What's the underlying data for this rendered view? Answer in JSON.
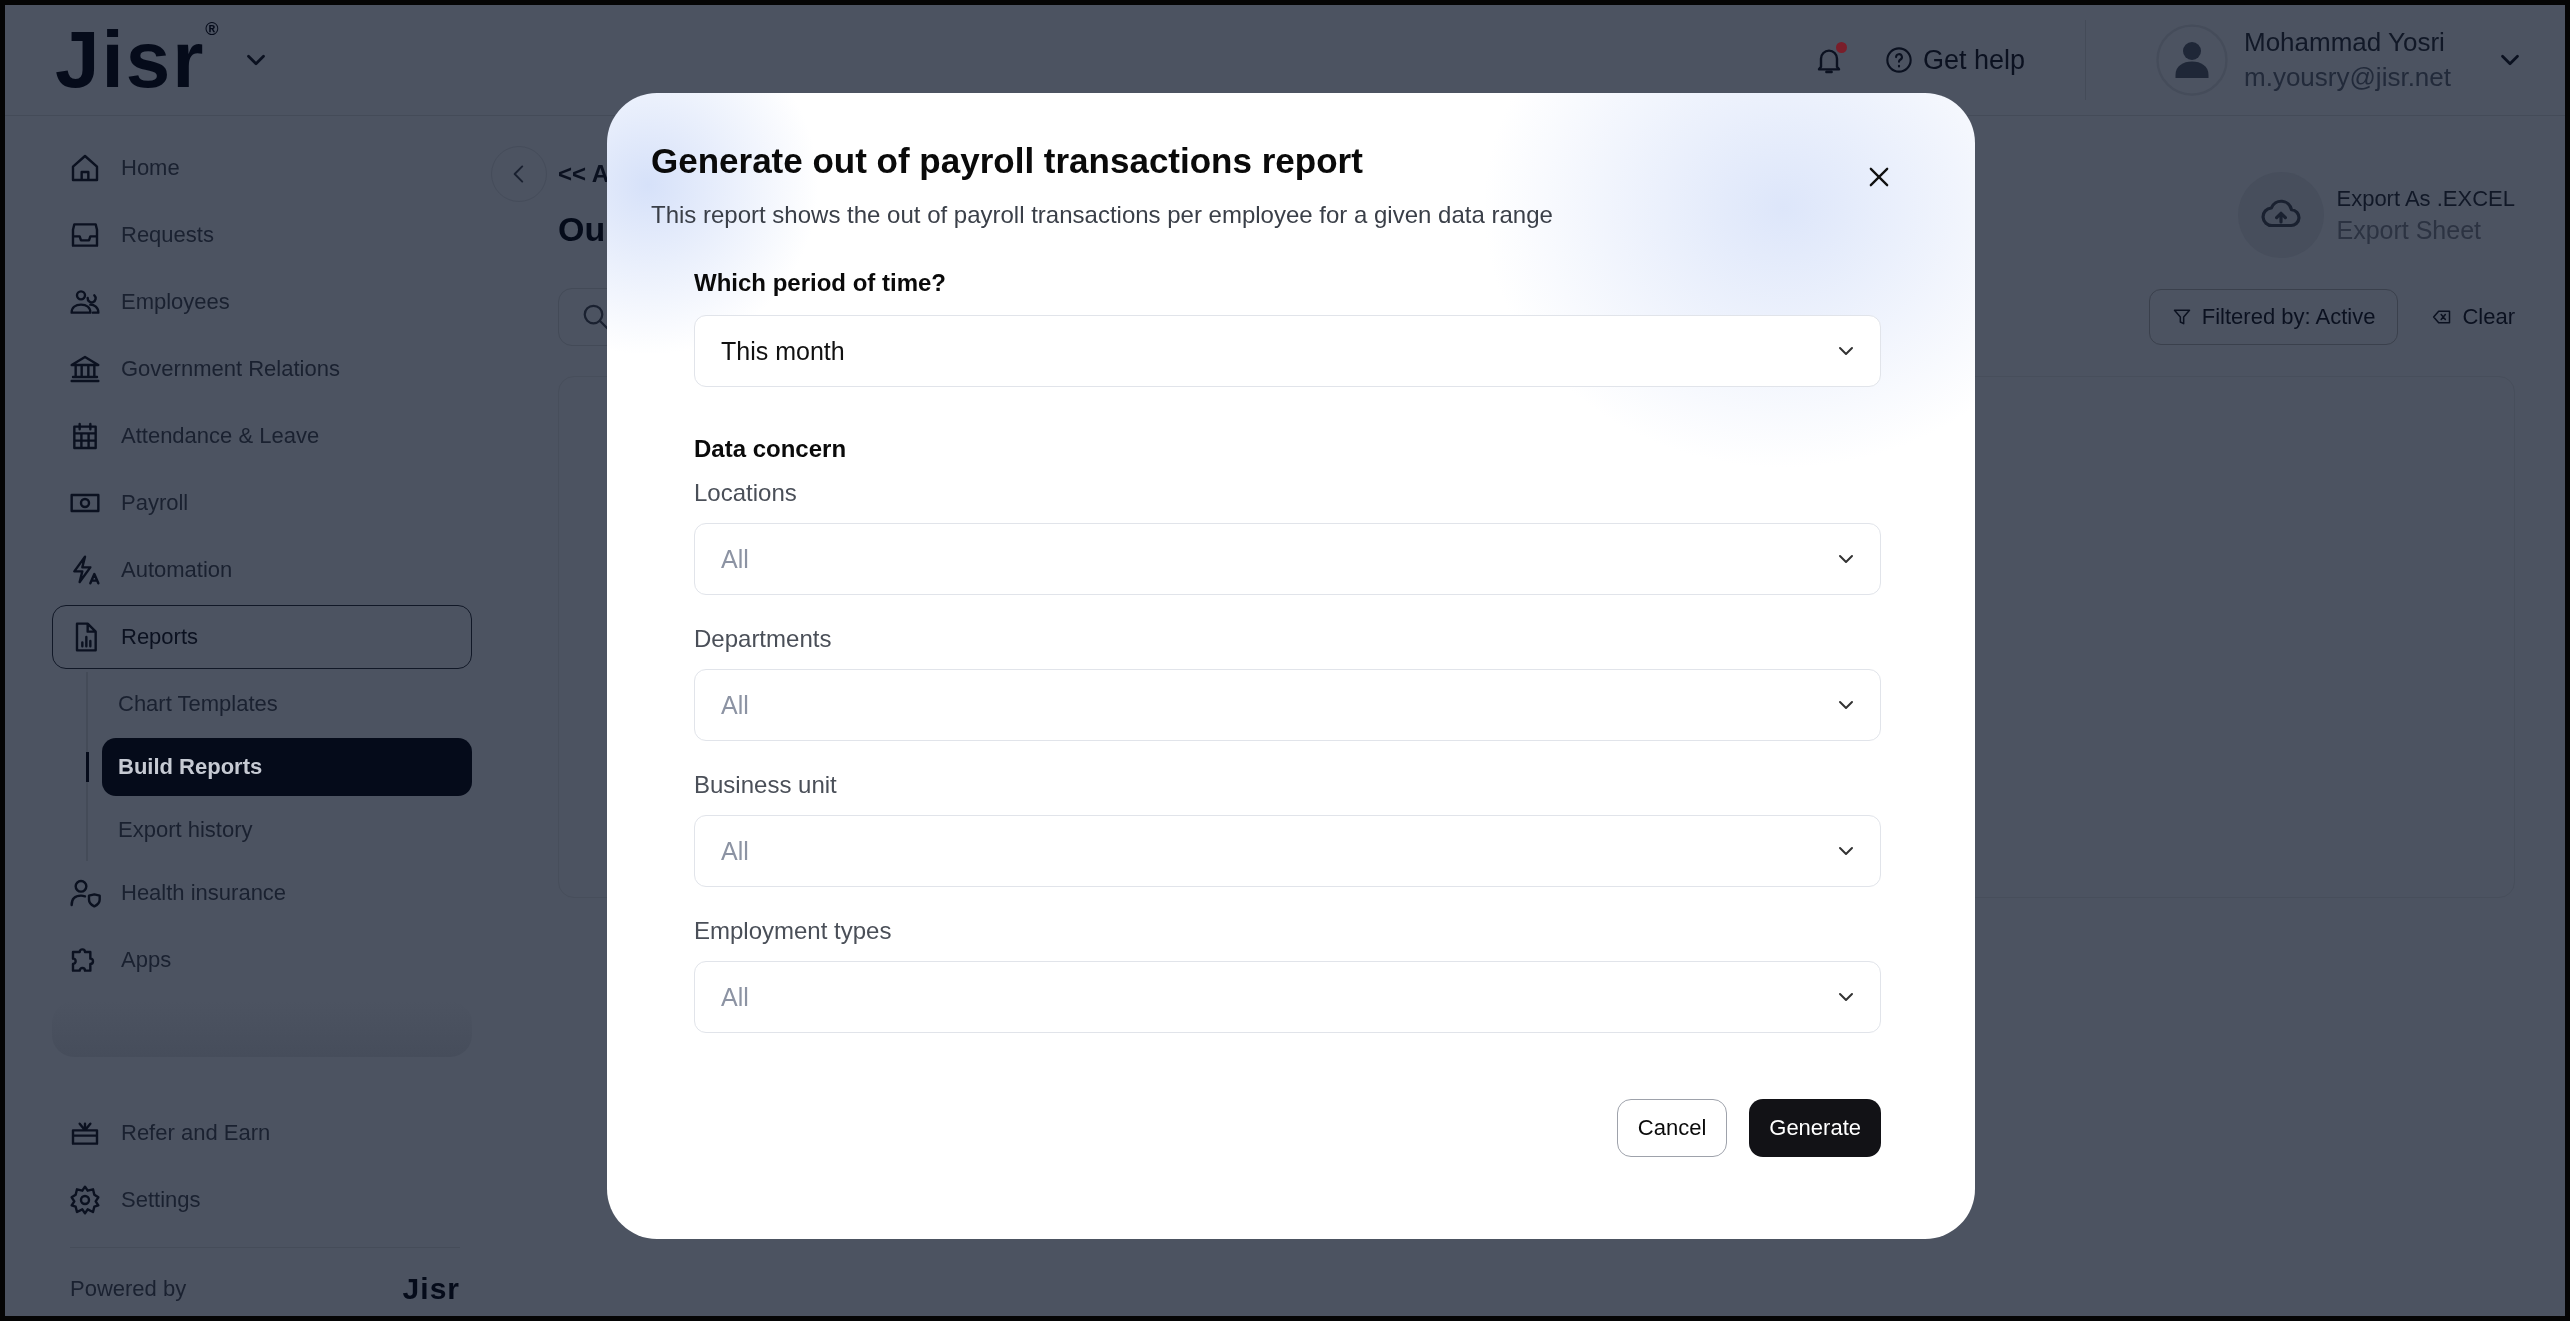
{
  "header": {
    "logo": "Jisr",
    "logo_mark": "®",
    "notifications": {
      "unread": true
    },
    "help": "Get help",
    "user": {
      "name": "Mohammad Yosri",
      "email": "m.yousry@jisr.net"
    }
  },
  "sidebar": {
    "items": [
      {
        "label": "Home",
        "selected": false
      },
      {
        "label": "Requests",
        "selected": false
      },
      {
        "label": "Employees",
        "selected": false
      },
      {
        "label": "Government Relations",
        "selected": false
      },
      {
        "label": "Attendance & Leave",
        "selected": false
      },
      {
        "label": "Payroll",
        "selected": false
      },
      {
        "label": "Automation",
        "selected": false
      },
      {
        "label": "Reports",
        "selected": true,
        "children": [
          {
            "label": "Chart Templates",
            "selected": false
          },
          {
            "label": "Build Reports",
            "selected": true
          },
          {
            "label": "Export history",
            "selected": false
          }
        ]
      },
      {
        "label": "Health insurance",
        "selected": false
      },
      {
        "label": "Apps",
        "selected": false
      }
    ],
    "secondary": [
      {
        "label": "Refer and Earn"
      },
      {
        "label": "Settings"
      }
    ],
    "footer": {
      "label": "Powered by",
      "logo": "Jisr"
    }
  },
  "main": {
    "breadcrumb": "<< A",
    "title": "Ou",
    "export": {
      "title": "Export As .EXCEL",
      "subtitle": "Export Sheet"
    },
    "filter": "Filtered by: Active",
    "clear": "Clear"
  },
  "modal": {
    "title": "Generate out of payroll transactions report",
    "description": "This report shows the out of payroll transactions per employee for a given data range",
    "period": {
      "label": "Which period of time?",
      "value": "This month"
    },
    "section": "Data concern",
    "filters": [
      {
        "label": "Locations",
        "placeholder": "All"
      },
      {
        "label": "Departments",
        "placeholder": "All"
      },
      {
        "label": "Business unit",
        "placeholder": "All"
      },
      {
        "label": "Employment types",
        "placeholder": "All"
      }
    ],
    "buttons": {
      "cancel": "Cancel",
      "generate": "Generate"
    }
  }
}
